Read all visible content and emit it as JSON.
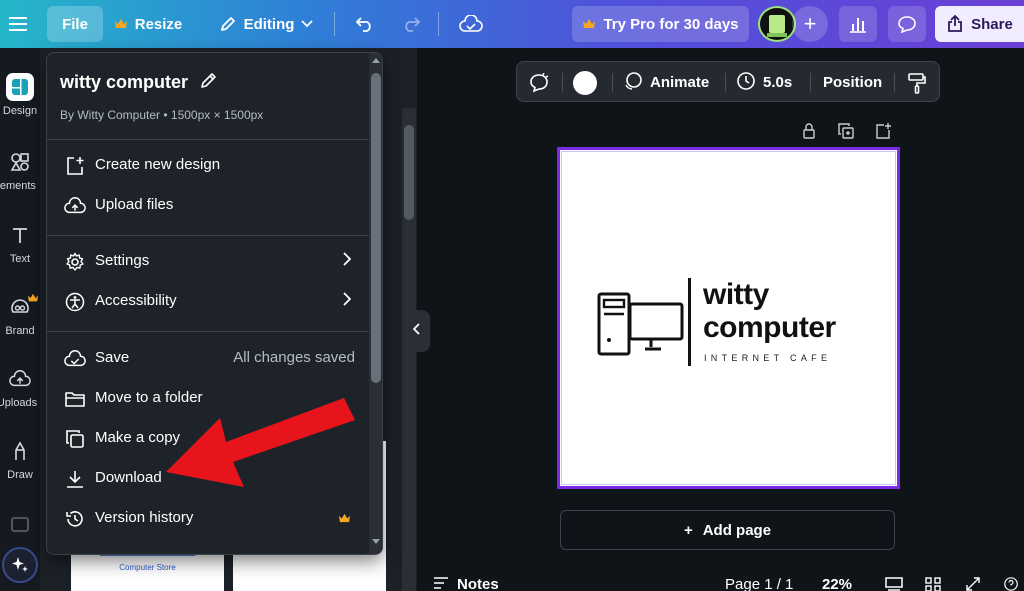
{
  "topbar": {
    "file_label": "File",
    "resize_label": "Resize",
    "editing_label": "Editing",
    "trypro_label": "Try Pro for 30 days",
    "share_label": "Share"
  },
  "rail": {
    "items": [
      {
        "label": "Design",
        "icon": "design-icon"
      },
      {
        "label": "Elements",
        "icon": "elements-icon"
      },
      {
        "label": "Text",
        "icon": "text-icon"
      },
      {
        "label": "Brand",
        "icon": "brand-icon"
      },
      {
        "label": "Uploads",
        "icon": "uploads-icon"
      },
      {
        "label": "Draw",
        "icon": "draw-icon"
      }
    ]
  },
  "file_menu": {
    "title": "witty computer",
    "subtitle": "By Witty Computer • 1500px × 1500px",
    "items": [
      {
        "label": "Create new design",
        "icon": "plus-square-icon"
      },
      {
        "label": "Upload files",
        "icon": "cloud-upload-icon"
      },
      {
        "label": "Settings",
        "icon": "gear-icon"
      },
      {
        "label": "Accessibility",
        "icon": "accessibility-icon"
      },
      {
        "label": "Save",
        "icon": "cloud-check-icon",
        "status": "All changes saved"
      },
      {
        "label": "Move to a folder",
        "icon": "folder-icon"
      },
      {
        "label": "Make a copy",
        "icon": "copy-icon"
      },
      {
        "label": "Download",
        "icon": "download-icon"
      },
      {
        "label": "Version history",
        "icon": "history-icon"
      }
    ]
  },
  "side_panel": {
    "thumb_caption": "Computer Store"
  },
  "canvas_toolbar": {
    "animate_label": "Animate",
    "duration_label": "5.0s",
    "position_label": "Position"
  },
  "design": {
    "brand_name_line1": "witty",
    "brand_name_line2": "computer",
    "tagline": "INTERNET CAFE"
  },
  "canvas": {
    "add_page_label": "Add page"
  },
  "bottom_bar": {
    "notes_label": "Notes",
    "page_indicator": "Page 1 / 1",
    "zoom": "22%"
  },
  "colors": {
    "accent_purple": "#7d2ae8",
    "annotation_red": "#e8141b",
    "crown_gold": "#f5a623"
  }
}
